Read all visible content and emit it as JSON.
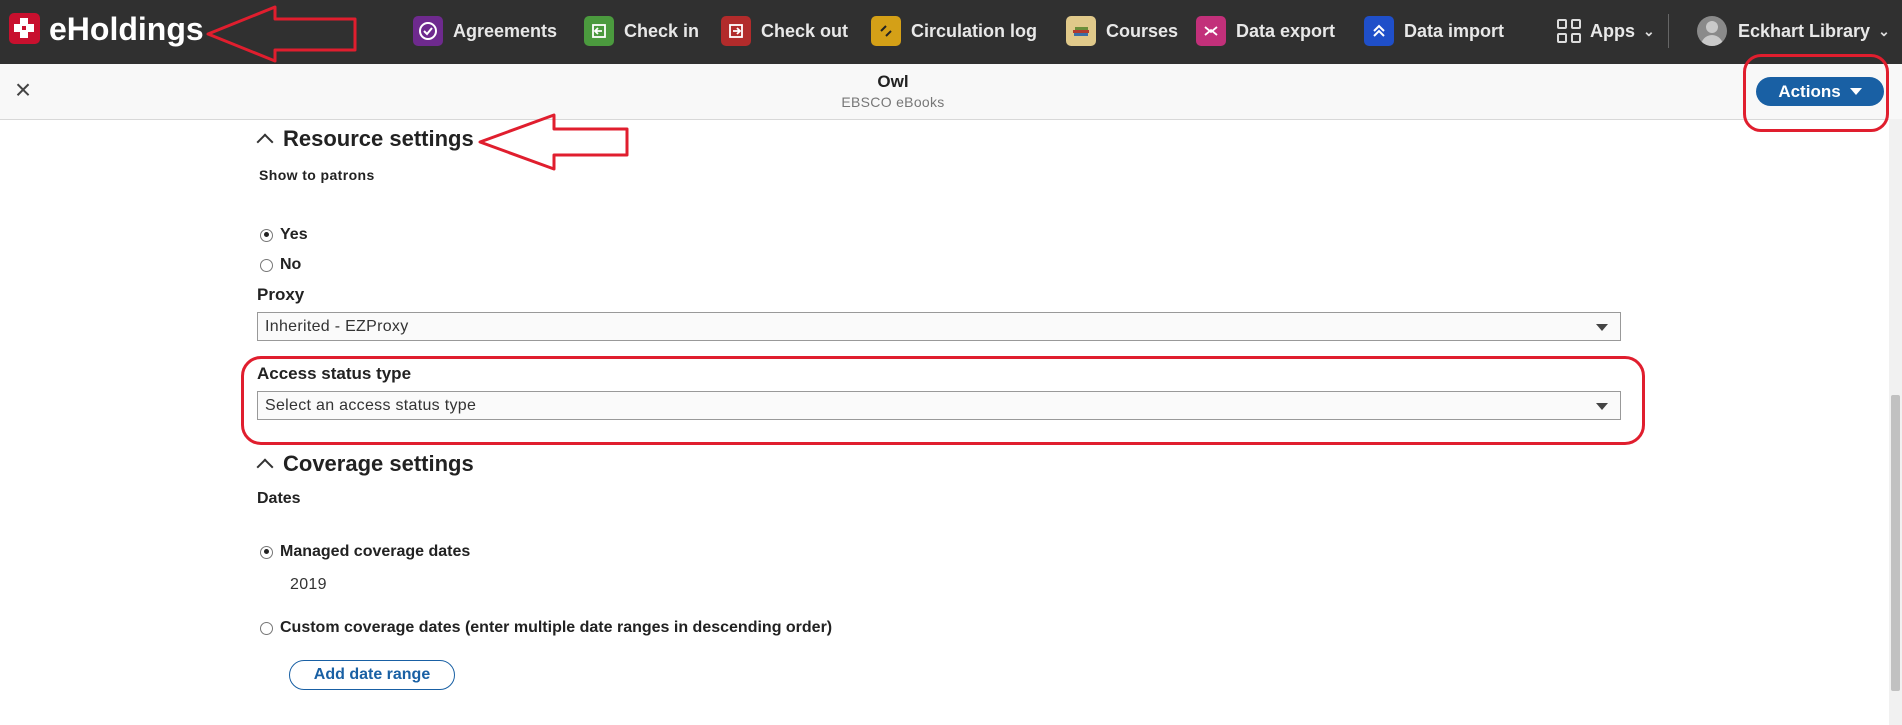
{
  "app": {
    "name": "eHoldings"
  },
  "nav": {
    "items": [
      {
        "label": "Agreements",
        "icon": "agreements-icon",
        "color": "#6e2a8e"
      },
      {
        "label": "Check in",
        "icon": "check-in-icon",
        "color": "#4b9a3e"
      },
      {
        "label": "Check out",
        "icon": "check-out-icon",
        "color": "#b22b2b"
      },
      {
        "label": "Circulation log",
        "icon": "circulation-log-icon",
        "color": "#d4a017"
      },
      {
        "label": "Courses",
        "icon": "courses-icon",
        "color": "#e0c98a"
      },
      {
        "label": "Data export",
        "icon": "data-export-icon",
        "color": "#c2307a"
      },
      {
        "label": "Data import",
        "icon": "data-import-icon",
        "color": "#1f4fc9"
      }
    ],
    "apps_label": "Apps",
    "user_label": "Eckhart Library"
  },
  "pane": {
    "title": "Owl",
    "subtitle": "EBSCO eBooks",
    "actions_label": "Actions"
  },
  "resource_settings": {
    "heading": "Resource settings",
    "show_to_patrons_label": "Show to patrons",
    "options": [
      {
        "label": "Yes",
        "selected": true
      },
      {
        "label": "No",
        "selected": false
      }
    ],
    "proxy_label": "Proxy",
    "proxy_value": "Inherited - EZProxy",
    "access_status_label": "Access status type",
    "access_status_placeholder": "Select an access status type"
  },
  "coverage_settings": {
    "heading": "Coverage settings",
    "dates_label": "Dates",
    "managed_label": "Managed coverage dates",
    "managed_selected": true,
    "managed_value": "2019",
    "custom_label": "Custom coverage dates (enter multiple date ranges in descending order)",
    "custom_selected": false,
    "add_date_range_label": "Add date range"
  },
  "colors": {
    "nav_bg": "#303030",
    "accent": "#1960a4",
    "annotation": "#e01e2e",
    "logo": "#c8102e"
  }
}
